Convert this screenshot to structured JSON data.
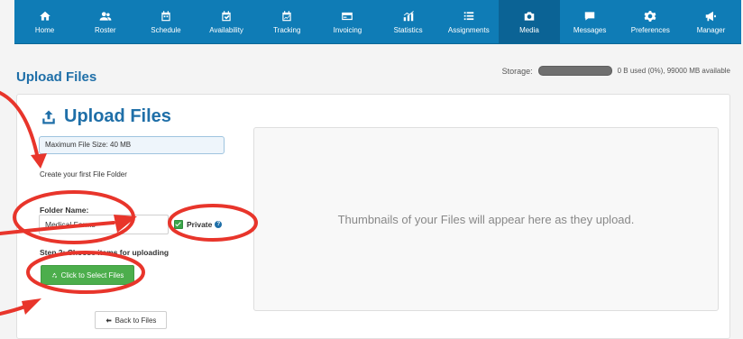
{
  "nav": {
    "items": [
      {
        "label": "Home",
        "icon": "home-icon"
      },
      {
        "label": "Roster",
        "icon": "roster-icon"
      },
      {
        "label": "Schedule",
        "icon": "calendar-icon"
      },
      {
        "label": "Availability",
        "icon": "availability-icon"
      },
      {
        "label": "Tracking",
        "icon": "tracking-icon"
      },
      {
        "label": "Invoicing",
        "icon": "invoicing-icon"
      },
      {
        "label": "Statistics",
        "icon": "statistics-icon"
      },
      {
        "label": "Assignments",
        "icon": "list-icon"
      },
      {
        "label": "Media",
        "icon": "camera-icon"
      },
      {
        "label": "Messages",
        "icon": "chat-icon"
      },
      {
        "label": "Preferences",
        "icon": "gear-icon"
      },
      {
        "label": "Manager",
        "icon": "megaphone-icon"
      }
    ],
    "active": "Media"
  },
  "page": {
    "title": "Upload Files",
    "storage_label": "Storage:",
    "storage_text": "0 B used (0%), 99000 MB available",
    "storage_percent": 0
  },
  "card": {
    "title": "Upload Files",
    "max_size": "Maximum File Size: 40 MB",
    "first_folder": "Create your first File Folder",
    "folder_label": "Folder Name:",
    "folder_value": "Medical Forms",
    "private_label": "Private",
    "step_label": "Step 2: Choose items for uploading",
    "select_button": "Click to Select Files",
    "back_button": "Back to Files",
    "thumbnails_text": "Thumbnails of your Files will appear here as they upload."
  },
  "colors": {
    "nav_bg": "#0f7cb6",
    "accent": "#1f6fa8",
    "button_green": "#4cae4c",
    "annotation_red": "#e8352b"
  }
}
